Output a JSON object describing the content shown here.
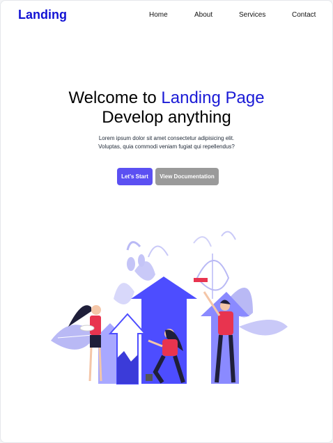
{
  "nav": {
    "logo": "Landing",
    "links": [
      "Home",
      "About",
      "Services",
      "Contact"
    ]
  },
  "hero": {
    "title_prefix": "Welcome to",
    "title_accent": "Landing Page",
    "title_line2": "Develop anything",
    "description_line1": "Lorem ipsum dolor sit amet consectetur adipisicing elit.",
    "description_line2": "Voluptas, quia commodi veniam fugiat qui repellendus?",
    "primary_button": "Let's Start",
    "secondary_button": "View Documentation"
  },
  "colors": {
    "brand": "#1212d4",
    "accent": "#1a1ad6",
    "primary_button": "#5b50f2",
    "secondary_button": "#9a9a9a",
    "illustration_primary": "#4d4dff",
    "illustration_figures": "#e8344f"
  }
}
